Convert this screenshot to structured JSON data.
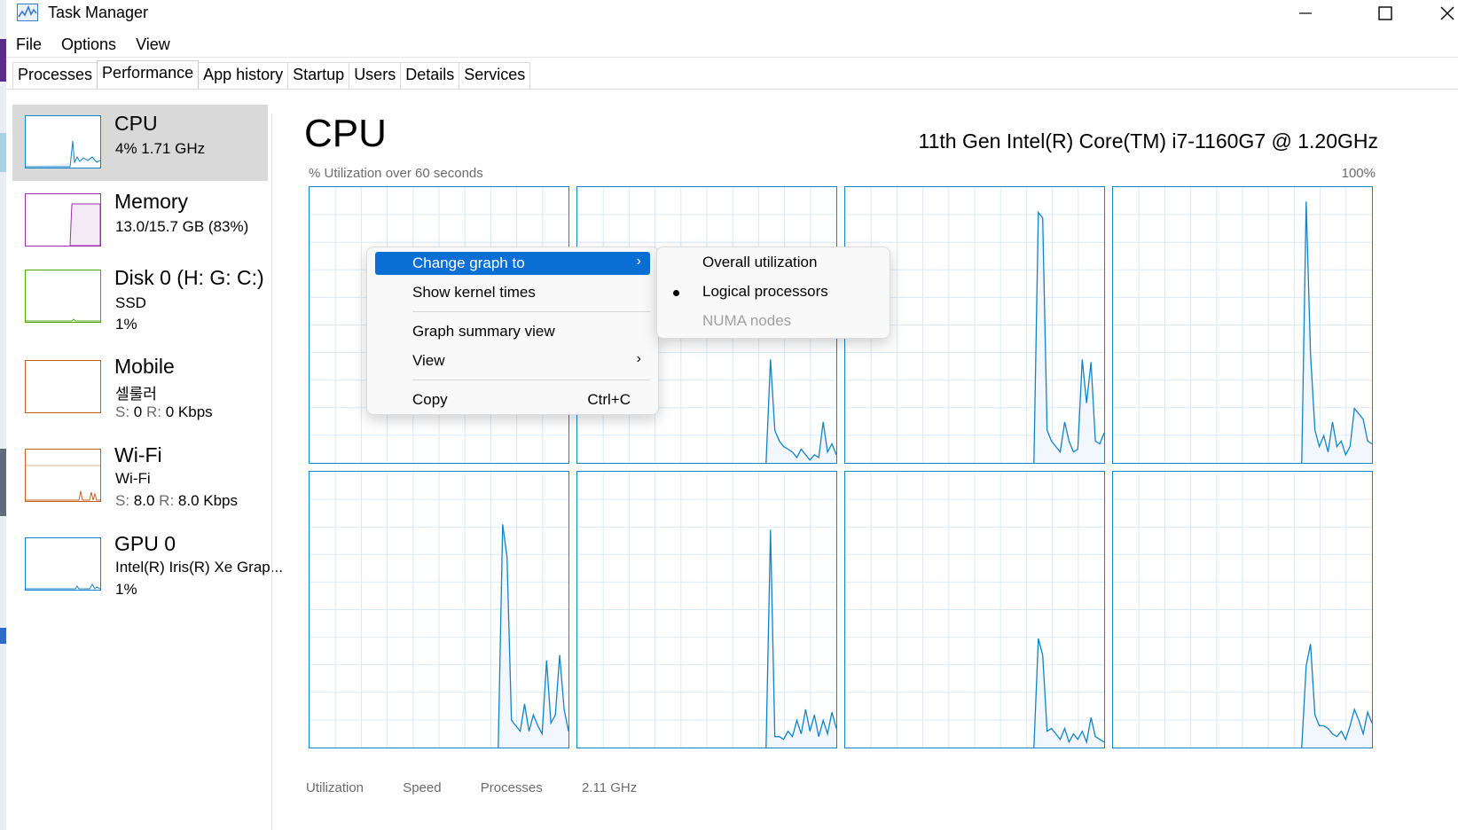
{
  "window": {
    "title": "Task Manager",
    "controls": [
      "minimize",
      "maximize",
      "close"
    ]
  },
  "menu": [
    "File",
    "Options",
    "View"
  ],
  "tabs": [
    {
      "label": "Processes",
      "active": false
    },
    {
      "label": "Performance",
      "active": true
    },
    {
      "label": "App history",
      "active": false
    },
    {
      "label": "Startup",
      "active": false
    },
    {
      "label": "Users",
      "active": false
    },
    {
      "label": "Details",
      "active": false
    },
    {
      "label": "Services",
      "active": false
    }
  ],
  "sidebar": {
    "items": [
      {
        "title": "CPU",
        "line1": "4%  1.71 GHz",
        "line2": "",
        "color": "#1183c8",
        "selected": true
      },
      {
        "title": "Memory",
        "line1": "13.0/15.7 GB (83%)",
        "line2": "",
        "color": "#9b2fae",
        "selected": false
      },
      {
        "title": "Disk 0 (H: G: C:)",
        "line1": "SSD",
        "line2": "1%",
        "color": "#4da60c",
        "selected": false
      },
      {
        "title": "Mobile",
        "line1": "셀룰러",
        "line2_s_label": "S:",
        "line2_s": "0",
        "line2_r_label": "R:",
        "line2_r": "0 Kbps",
        "color": "#c4621b",
        "selected": false
      },
      {
        "title": "Wi-Fi",
        "line1": "Wi-Fi",
        "line2_s_label": "S:",
        "line2_s": "8.0",
        "line2_r_label": "R:",
        "line2_r": "8.0 Kbps",
        "color": "#c4621b",
        "selected": false
      },
      {
        "title": "GPU 0",
        "line1": "Intel(R) Iris(R) Xe Grap...",
        "line2": "1%",
        "color": "#1183c8",
        "selected": false
      }
    ]
  },
  "main": {
    "title": "CPU",
    "cpu_model": "11th Gen Intel(R) Core(TM) i7-1160G7 @ 1.20GHz",
    "util_label": "% Utilization over 60 seconds",
    "util_max": "100%",
    "line_color": "#1183c8",
    "fill_color": "#f1f7fc",
    "grid_color": "#d9eaf7",
    "bottom_labels": [
      "Utilization",
      "Speed",
      "Processes",
      "2.11 GHz"
    ]
  },
  "context_menu": {
    "items": [
      {
        "label": "Change graph to",
        "highlighted": true,
        "submenu": true
      },
      {
        "label": "Show kernel times"
      },
      {
        "label": "Graph summary view"
      },
      {
        "label": "View",
        "submenu": true
      },
      {
        "label": "Copy",
        "accelerator": "Ctrl+C"
      }
    ],
    "submenu": [
      {
        "label": "Overall utilization",
        "checked": false,
        "disabled": false
      },
      {
        "label": "Logical processors",
        "checked": true,
        "disabled": false
      },
      {
        "label": "NUMA nodes",
        "checked": false,
        "disabled": true
      }
    ]
  },
  "chart_data": {
    "type": "area",
    "title": "% Utilization over 60 seconds",
    "ylim": [
      0,
      100
    ],
    "series": [
      {
        "values": [
          0,
          0,
          0,
          0,
          0,
          0,
          0,
          0,
          0,
          0,
          0,
          0,
          0,
          0,
          0,
          0,
          0,
          0,
          0,
          0,
          0,
          0,
          0,
          0,
          0,
          0,
          0,
          0,
          0,
          0,
          0,
          0,
          0,
          0,
          0,
          0,
          0,
          0,
          0,
          0,
          0,
          0,
          0,
          0,
          0,
          0,
          0,
          0,
          0,
          0,
          0,
          0,
          0,
          0,
          0,
          0,
          0,
          0,
          0,
          0
        ]
      },
      {
        "values": [
          0,
          0,
          0,
          0,
          0,
          0,
          0,
          0,
          0,
          0,
          0,
          0,
          0,
          0,
          0,
          0,
          0,
          0,
          0,
          0,
          0,
          0,
          0,
          0,
          0,
          0,
          0,
          0,
          0,
          0,
          0,
          0,
          0,
          0,
          0,
          0,
          0,
          0,
          0,
          0,
          0,
          0,
          0,
          0,
          38,
          12,
          8,
          6,
          5,
          4,
          2,
          5,
          3,
          1,
          3,
          2,
          15,
          4,
          7,
          3
        ]
      },
      {
        "values": [
          0,
          0,
          0,
          0,
          0,
          0,
          0,
          0,
          0,
          0,
          0,
          0,
          0,
          0,
          0,
          0,
          0,
          0,
          0,
          0,
          0,
          0,
          0,
          0,
          0,
          0,
          0,
          0,
          0,
          0,
          0,
          0,
          0,
          0,
          0,
          0,
          0,
          0,
          0,
          0,
          0,
          0,
          0,
          0,
          92,
          90,
          12,
          8,
          6,
          4,
          15,
          8,
          4,
          5,
          38,
          22,
          37,
          8,
          7,
          11
        ]
      },
      {
        "values": [
          0,
          0,
          0,
          0,
          0,
          0,
          0,
          0,
          0,
          0,
          0,
          0,
          0,
          0,
          0,
          0,
          0,
          0,
          0,
          0,
          0,
          0,
          0,
          0,
          0,
          0,
          0,
          0,
          0,
          0,
          0,
          0,
          0,
          0,
          0,
          0,
          0,
          0,
          0,
          0,
          0,
          0,
          0,
          0,
          96,
          40,
          12,
          6,
          10,
          4,
          15,
          6,
          8,
          3,
          6,
          20,
          18,
          16,
          8,
          7
        ]
      },
      {
        "values": [
          0,
          0,
          0,
          0,
          0,
          0,
          0,
          0,
          0,
          0,
          0,
          0,
          0,
          0,
          0,
          0,
          0,
          0,
          0,
          0,
          0,
          0,
          0,
          0,
          0,
          0,
          0,
          0,
          0,
          0,
          0,
          0,
          0,
          0,
          0,
          0,
          0,
          0,
          0,
          0,
          0,
          0,
          0,
          0,
          82,
          70,
          10,
          8,
          6,
          16,
          6,
          12,
          8,
          5,
          32,
          9,
          12,
          34,
          14,
          6
        ]
      },
      {
        "values": [
          0,
          0,
          0,
          0,
          0,
          0,
          0,
          0,
          0,
          0,
          0,
          0,
          0,
          0,
          0,
          0,
          0,
          0,
          0,
          0,
          0,
          0,
          0,
          0,
          0,
          0,
          0,
          0,
          0,
          0,
          0,
          0,
          0,
          0,
          0,
          0,
          0,
          0,
          0,
          0,
          0,
          0,
          0,
          0,
          80,
          4,
          4,
          3,
          6,
          4,
          10,
          5,
          14,
          6,
          12,
          4,
          10,
          5,
          13,
          7
        ]
      },
      {
        "values": [
          0,
          0,
          0,
          0,
          0,
          0,
          0,
          0,
          0,
          0,
          0,
          0,
          0,
          0,
          0,
          0,
          0,
          0,
          0,
          0,
          0,
          0,
          0,
          0,
          0,
          0,
          0,
          0,
          0,
          0,
          0,
          0,
          0,
          0,
          0,
          0,
          0,
          0,
          0,
          0,
          0,
          0,
          0,
          0,
          40,
          34,
          6,
          7,
          5,
          3,
          7,
          2,
          5,
          3,
          6,
          2,
          11,
          4,
          3,
          2
        ]
      },
      {
        "values": [
          0,
          0,
          0,
          0,
          0,
          0,
          0,
          0,
          0,
          0,
          0,
          0,
          0,
          0,
          0,
          0,
          0,
          0,
          0,
          0,
          0,
          0,
          0,
          0,
          0,
          0,
          0,
          0,
          0,
          0,
          0,
          0,
          0,
          0,
          0,
          0,
          0,
          0,
          0,
          0,
          0,
          0,
          0,
          0,
          30,
          38,
          12,
          8,
          8,
          7,
          5,
          4,
          6,
          3,
          8,
          14,
          10,
          5,
          13,
          9
        ]
      }
    ]
  }
}
